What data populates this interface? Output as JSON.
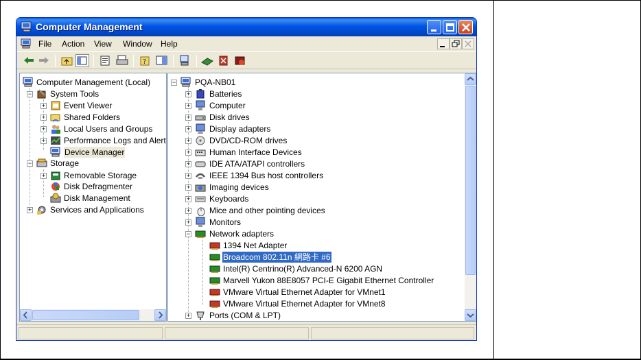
{
  "window": {
    "title": "Computer Management"
  },
  "menu": {
    "items": [
      "File",
      "Action",
      "View",
      "Window",
      "Help"
    ]
  },
  "left_tree": {
    "root": "Computer Management (Local)",
    "system_tools": "System Tools",
    "event_viewer": "Event Viewer",
    "shared_folders": "Shared Folders",
    "local_users": "Local Users and Groups",
    "perf_logs": "Performance Logs and Alerts",
    "device_manager": "Device Manager",
    "storage": "Storage",
    "removable_storage": "Removable Storage",
    "disk_defrag": "Disk Defragmenter",
    "disk_mgmt": "Disk Management",
    "services": "Services and Applications"
  },
  "right_tree": {
    "root": "PQA-NB01",
    "categories": {
      "batteries": "Batteries",
      "computer": "Computer",
      "disk_drives": "Disk drives",
      "display": "Display adapters",
      "dvd": "DVD/CD-ROM drives",
      "hid": "Human Interface Devices",
      "ide": "IDE ATA/ATAPI controllers",
      "ieee": "IEEE 1394 Bus host controllers",
      "imaging": "Imaging devices",
      "keyboards": "Keyboards",
      "mice": "Mice and other pointing devices",
      "monitors": "Monitors",
      "network": "Network adapters",
      "ports": "Ports (COM & LPT)"
    },
    "adapters": [
      "1394 Net Adapter",
      "Broadcom 802.11n 網路卡 #6",
      "Intel(R) Centrino(R) Advanced-N 6200 AGN",
      "Marvell Yukon 88E8057 PCI-E Gigabit Ethernet Controller",
      "VMware Virtual Ethernet Adapter for VMnet1",
      "VMware Virtual Ethernet Adapter for VMnet8"
    ]
  },
  "colors": {
    "title_bar": "#0054e3",
    "selection": "#316ac5",
    "close_button": "#c9421b"
  }
}
